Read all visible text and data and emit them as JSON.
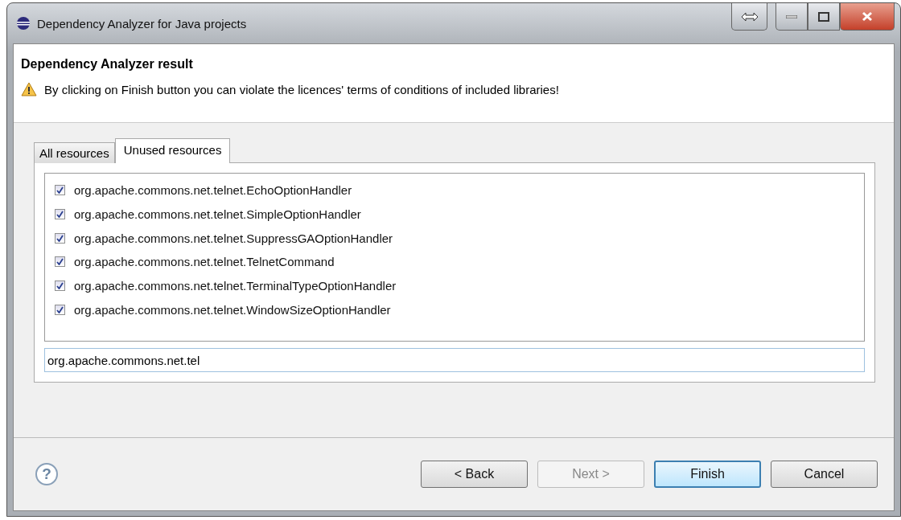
{
  "window": {
    "title": "Dependency Analyzer for Java projects"
  },
  "header": {
    "title": "Dependency Analyzer result",
    "message": "By clicking on Finish button you can violate the licences' terms of conditions of included libraries!"
  },
  "tabs": [
    {
      "label": "All resources",
      "selected": false
    },
    {
      "label": "Unused resources",
      "selected": true
    }
  ],
  "resources": [
    {
      "name": "org.apache.commons.net.telnet.EchoOptionHandler",
      "checked": true
    },
    {
      "name": "org.apache.commons.net.telnet.SimpleOptionHandler",
      "checked": true
    },
    {
      "name": "org.apache.commons.net.telnet.SuppressGAOptionHandler",
      "checked": true
    },
    {
      "name": "org.apache.commons.net.telnet.TelnetCommand",
      "checked": true
    },
    {
      "name": "org.apache.commons.net.telnet.TerminalTypeOptionHandler",
      "checked": true
    },
    {
      "name": "org.apache.commons.net.telnet.WindowSizeOptionHandler",
      "checked": true
    }
  ],
  "filter": {
    "value": "org.apache.commons.net.tel"
  },
  "help": {
    "label": "?"
  },
  "buttons": [
    {
      "label": "< Back",
      "disabled": false,
      "default": false
    },
    {
      "label": "Next >",
      "disabled": true,
      "default": false
    },
    {
      "label": "Finish",
      "disabled": false,
      "default": true
    },
    {
      "label": "Cancel",
      "disabled": false,
      "default": false
    }
  ]
}
